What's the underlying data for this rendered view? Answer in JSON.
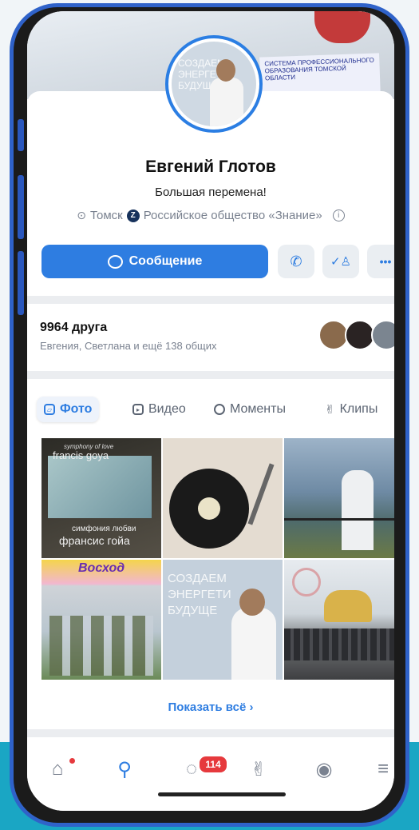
{
  "profile": {
    "name": "Евгений Глотов",
    "status": "Большая перемена!",
    "city": "Томск",
    "organization": "Российское общество «Знание»"
  },
  "cover": {
    "banner_text": "СИСТЕМА ПРОФЕССИОНАЛЬНОГО ОБРАЗОВАНИЯ ТОМСКОЙ ОБЛАСТИ"
  },
  "avatar": {
    "text": "СОЗДАЕМ ЭНЕРГЕТИ БУДУЩЕ"
  },
  "actions": {
    "message_label": "Сообщение"
  },
  "friends": {
    "count": "9964 друга",
    "mutual": "Евгения, Светлана и ещё 138 общих"
  },
  "tabs": [
    {
      "label": "Фото",
      "icon": "photo-icon"
    },
    {
      "label": "Видео",
      "icon": "video-icon"
    },
    {
      "label": "Моменты",
      "icon": "moments-icon"
    },
    {
      "label": "Клипы",
      "icon": "clips-icon"
    }
  ],
  "photos": {
    "p1_title": "symphony of love",
    "p1_artist": "francis goya",
    "p1_caption": "симфония любви",
    "p1_caption2": "франсис гойа",
    "p4_sign": "Восход",
    "p5_text": "СОЗДАЕМ ЭНЕРГЕТИ БУДУЩЕ"
  },
  "show_all": "Показать всё  ›",
  "nav": {
    "messages_badge": "114"
  },
  "colors": {
    "accent": "#2e7de1",
    "badge": "#e6393d",
    "frame": "#2f62c9",
    "background_band": "#1aa6c4"
  }
}
